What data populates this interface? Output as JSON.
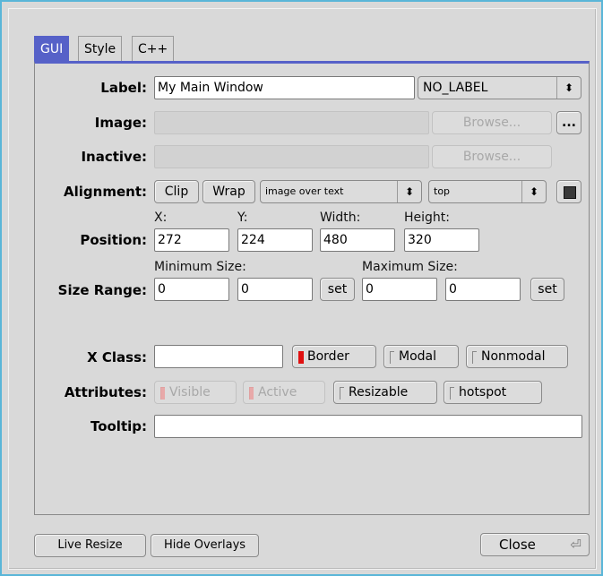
{
  "tabs": [
    "GUI",
    "Style",
    "C++"
  ],
  "labels": {
    "label": "Label:",
    "image": "Image:",
    "inactive": "Inactive:",
    "alignment": "Alignment:",
    "position": "Position:",
    "size_range": "Size Range:",
    "x_class": "X Class:",
    "attributes": "Attributes:",
    "tooltip": "Tooltip:"
  },
  "label_value": "My Main Window",
  "label_type": "NO_LABEL",
  "image_value": "",
  "inactive_value": "",
  "browse_label": "Browse...",
  "more_label": "...",
  "alignment": {
    "clip": "Clip",
    "wrap": "Wrap",
    "image_pos": "image over text",
    "vertical": "top"
  },
  "position": {
    "x_label": "X:",
    "y_label": "Y:",
    "w_label": "Width:",
    "h_label": "Height:",
    "x": "272",
    "y": "224",
    "w": "480",
    "h": "320"
  },
  "size_range": {
    "min_label": "Minimum Size:",
    "max_label": "Maximum Size:",
    "min_w": "0",
    "min_h": "0",
    "max_w": "0",
    "max_h": "0",
    "set": "set"
  },
  "xclass_value": "",
  "window_toggles": {
    "border": "Border",
    "modal": "Modal",
    "nonmodal": "Nonmodal"
  },
  "attributes": {
    "visible": "Visible",
    "active": "Active",
    "resizable": "Resizable",
    "hotspot": "hotspot"
  },
  "tooltip_value": "",
  "footer": {
    "live_resize": "Live Resize",
    "hide_overlays": "Hide Overlays",
    "close": "Close",
    "return_icon": "⏎"
  }
}
